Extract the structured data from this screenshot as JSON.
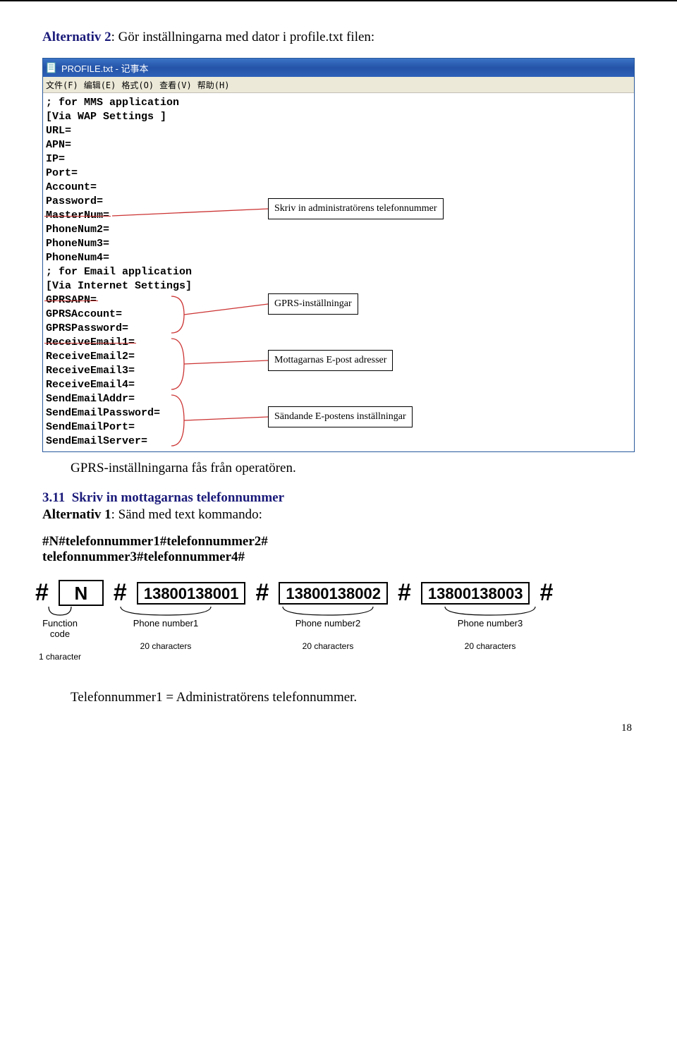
{
  "intro": {
    "prefix_bold": "Alternativ 2",
    "rest": ": Gör inställningarna med dator i profile.txt filen:"
  },
  "notepad": {
    "title": "PROFILE.txt - 记事本",
    "menus": [
      "文件(F)",
      "编辑(E)",
      "格式(O)",
      "查看(V)",
      "帮助(H)"
    ],
    "lines_pre_master": [
      "; for MMS application",
      "[Via WAP Settings ]",
      "URL=",
      "APN=",
      "IP=",
      "Port=",
      "Account=",
      "Password="
    ],
    "master_label": "MasterNum=",
    "lines_post_master_block1": [
      "PhoneNum2=",
      "PhoneNum3=",
      "PhoneNum4=",
      "; for Email application",
      "[Via Internet Settings]"
    ],
    "gprs_block": [
      "GPRSAPN=",
      "GPRSAccount=",
      "GPRSPassword="
    ],
    "recv_block": [
      "ReceiveEmail1=",
      "ReceiveEmail2=",
      "ReceiveEmail3=",
      "ReceiveEmail4="
    ],
    "send_block": [
      "SendEmailAddr=",
      "SendEmailPassword=",
      "SendEmailPort=",
      "SendEmailServer="
    ]
  },
  "callouts": {
    "admin": "Skriv in administratörens telefonnummer",
    "gprs": "GPRS-inställningar",
    "recv": "Mottagarnas E-post adresser",
    "send": "Sändande E-postens inställningar"
  },
  "body": {
    "gprs_note": "GPRS-inställningarna fås från operatören.",
    "section_number": "3.11",
    "section_title": "Skriv in mottagarnas telefonnummer",
    "alt1_bold": "Alternativ 1",
    "alt1_rest": ": Sänd med text kommando:",
    "cmd_line1": "#N#telefonnummer1#telefonnummer2#",
    "cmd_line2": "telefonnummer3#telefonnummer4#"
  },
  "hashdiag": {
    "letter": "N",
    "phones": [
      "13800138001",
      "13800138002",
      "13800138003"
    ],
    "func_label": "Function code",
    "func_note": "1 character",
    "pn_labels": [
      "Phone number1",
      "Phone number2",
      "Phone number3"
    ],
    "pn_note": "20 characters"
  },
  "final": "Telefonnummer1 = Administratörens telefonnummer.",
  "page_number": "18"
}
